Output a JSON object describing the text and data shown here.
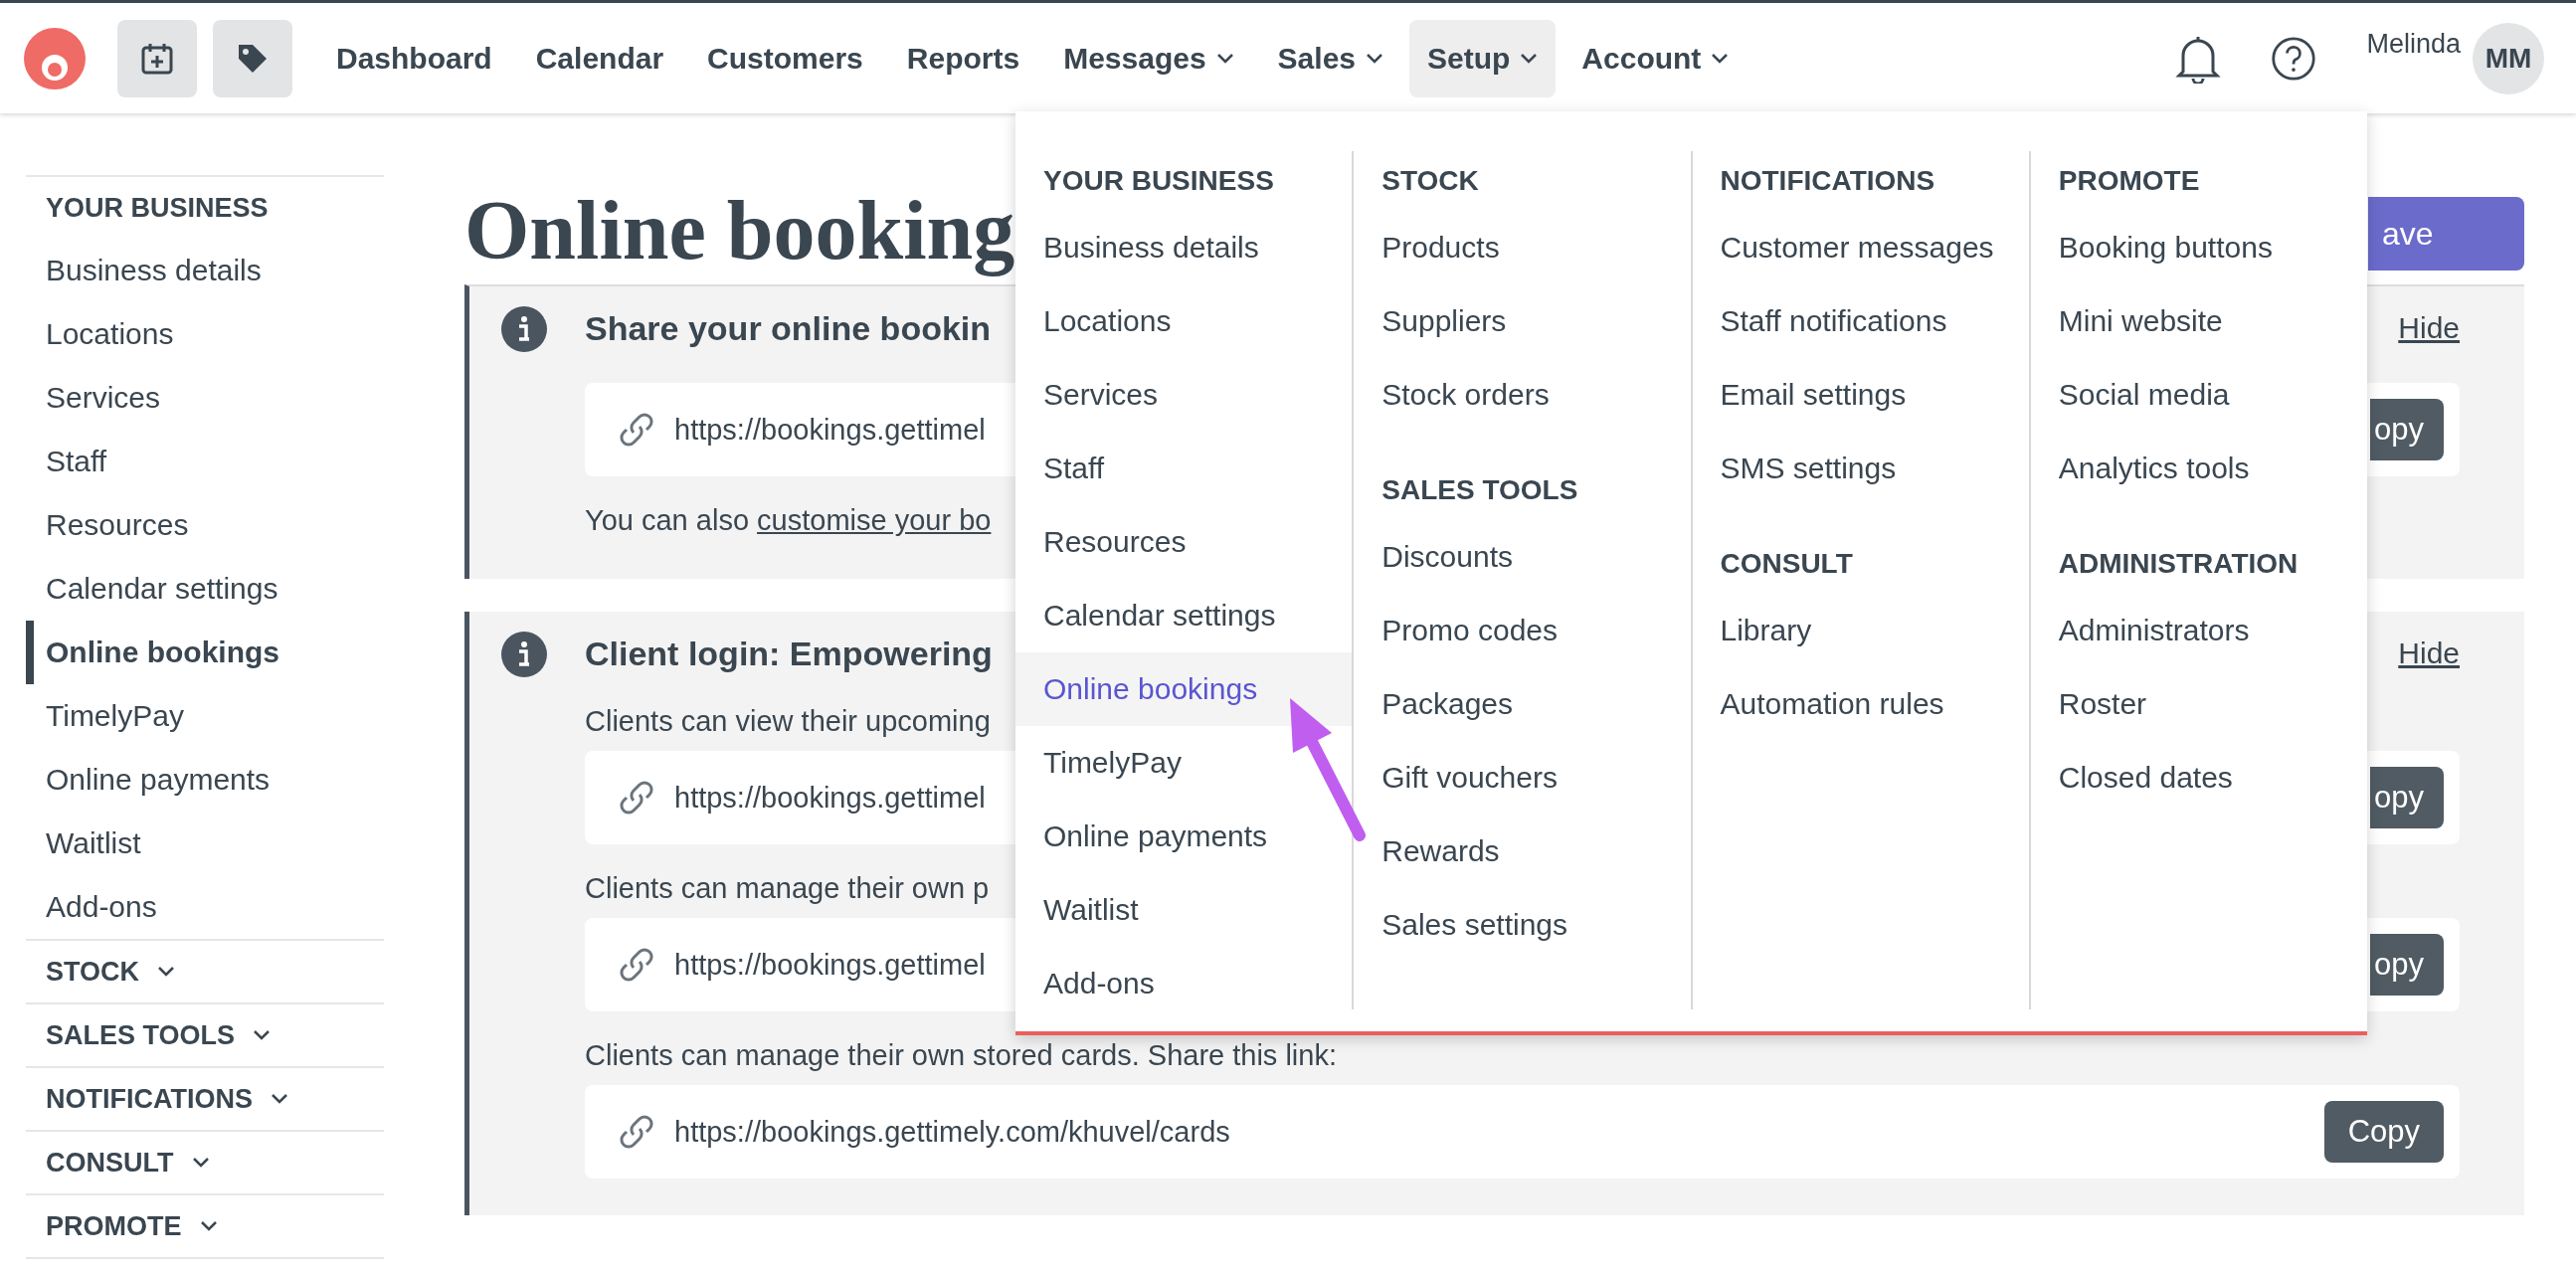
{
  "nav": {
    "items": [
      {
        "label": "Dashboard",
        "dropdown": false,
        "selected": false
      },
      {
        "label": "Calendar",
        "dropdown": false,
        "selected": false
      },
      {
        "label": "Customers",
        "dropdown": false,
        "selected": false
      },
      {
        "label": "Reports",
        "dropdown": false,
        "selected": false
      },
      {
        "label": "Messages",
        "dropdown": true,
        "selected": false
      },
      {
        "label": "Sales",
        "dropdown": true,
        "selected": false
      },
      {
        "label": "Setup",
        "dropdown": true,
        "selected": true
      },
      {
        "label": "Account",
        "dropdown": true,
        "selected": false
      }
    ],
    "user": {
      "name": "Melinda",
      "initials": "MM"
    }
  },
  "sidebar": {
    "sections": [
      {
        "title": "YOUR BUSINESS",
        "expanded": true,
        "items": [
          {
            "label": "Business details",
            "selected": false
          },
          {
            "label": "Locations",
            "selected": false
          },
          {
            "label": "Services",
            "selected": false
          },
          {
            "label": "Staff",
            "selected": false
          },
          {
            "label": "Resources",
            "selected": false
          },
          {
            "label": "Calendar settings",
            "selected": false
          },
          {
            "label": "Online bookings",
            "selected": true
          },
          {
            "label": "TimelyPay",
            "selected": false
          },
          {
            "label": "Online payments",
            "selected": false
          },
          {
            "label": "Waitlist",
            "selected": false
          },
          {
            "label": "Add-ons",
            "selected": false
          }
        ]
      },
      {
        "title": "STOCK",
        "expanded": false
      },
      {
        "title": "SALES TOOLS",
        "expanded": false
      },
      {
        "title": "NOTIFICATIONS",
        "expanded": false
      },
      {
        "title": "CONSULT",
        "expanded": false
      },
      {
        "title": "PROMOTE",
        "expanded": false
      }
    ]
  },
  "page": {
    "title": "Online booking",
    "save_button": "ave"
  },
  "cards": [
    {
      "title": "Share your online bookin",
      "hide": "Hide",
      "blocks": [
        {
          "kind": "link",
          "url": "https://bookings.gettimel",
          "copy": "opy"
        },
        {
          "kind": "text",
          "text": "You can also ",
          "link": "customise your bo"
        }
      ]
    },
    {
      "title": "Client login: Empowering",
      "hide": "Hide",
      "blocks": [
        {
          "kind": "text",
          "text": "Clients can view their upcoming"
        },
        {
          "kind": "link",
          "url": "https://bookings.gettimel",
          "copy": "opy"
        },
        {
          "kind": "text",
          "text": "Clients can manage their own p"
        },
        {
          "kind": "link",
          "url": "https://bookings.gettimel",
          "copy": "opy"
        },
        {
          "kind": "text",
          "text": "Clients can manage their own stored cards. Share this link:"
        },
        {
          "kind": "link",
          "url": "https://bookings.gettimely.com/khuvel/cards",
          "copy": "Copy"
        }
      ]
    }
  ],
  "menu": {
    "columns": [
      {
        "groups": [
          {
            "title": "YOUR BUSINESS",
            "items": [
              {
                "label": "Business details",
                "selected": false
              },
              {
                "label": "Locations",
                "selected": false
              },
              {
                "label": "Services",
                "selected": false
              },
              {
                "label": "Staff",
                "selected": false
              },
              {
                "label": "Resources",
                "selected": false
              },
              {
                "label": "Calendar settings",
                "selected": false
              },
              {
                "label": "Online bookings",
                "selected": true
              },
              {
                "label": "TimelyPay",
                "selected": false
              },
              {
                "label": "Online payments",
                "selected": false
              },
              {
                "label": "Waitlist",
                "selected": false
              },
              {
                "label": "Add-ons",
                "selected": false
              }
            ]
          }
        ]
      },
      {
        "groups": [
          {
            "title": "STOCK",
            "items": [
              {
                "label": "Products",
                "selected": false
              },
              {
                "label": "Suppliers",
                "selected": false
              },
              {
                "label": "Stock orders",
                "selected": false
              }
            ]
          },
          {
            "title": "SALES TOOLS",
            "items": [
              {
                "label": "Discounts",
                "selected": false
              },
              {
                "label": "Promo codes",
                "selected": false
              },
              {
                "label": "Packages",
                "selected": false
              },
              {
                "label": "Gift vouchers",
                "selected": false
              },
              {
                "label": "Rewards",
                "selected": false
              },
              {
                "label": "Sales settings",
                "selected": false
              }
            ]
          }
        ]
      },
      {
        "groups": [
          {
            "title": "NOTIFICATIONS",
            "items": [
              {
                "label": "Customer messages",
                "selected": false
              },
              {
                "label": "Staff notifications",
                "selected": false
              },
              {
                "label": "Email settings",
                "selected": false
              },
              {
                "label": "SMS settings",
                "selected": false
              }
            ]
          },
          {
            "title": "CONSULT",
            "items": [
              {
                "label": "Library",
                "selected": false
              },
              {
                "label": "Automation rules",
                "selected": false
              }
            ]
          }
        ]
      },
      {
        "groups": [
          {
            "title": "PROMOTE",
            "items": [
              {
                "label": "Booking buttons",
                "selected": false
              },
              {
                "label": "Mini website",
                "selected": false
              },
              {
                "label": "Social media",
                "selected": false
              },
              {
                "label": "Analytics tools",
                "selected": false
              }
            ]
          },
          {
            "title": "ADMINISTRATION",
            "items": [
              {
                "label": "Administrators",
                "selected": false
              },
              {
                "label": "Roster",
                "selected": false
              },
              {
                "label": "Closed dates",
                "selected": false
              }
            ]
          }
        ]
      }
    ]
  }
}
